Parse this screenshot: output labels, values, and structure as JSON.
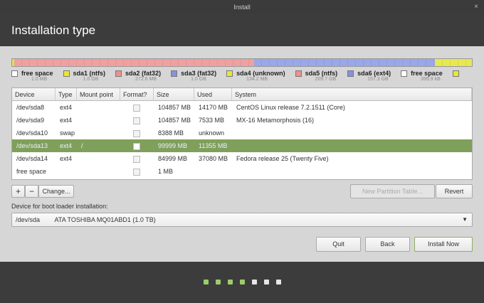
{
  "window": {
    "title": "Install",
    "close_icon": "×"
  },
  "header": {
    "title": "Installation type"
  },
  "partition_bar": [
    {
      "color": "#e0e050",
      "share": 0.4
    },
    {
      "color": "#f0a0a0",
      "share": 52.3
    },
    {
      "color": "#9aa8e8",
      "share": 39.2
    },
    {
      "color": "#e8e850",
      "share": 8.1
    }
  ],
  "legend": [
    {
      "name": "free space",
      "size": "1.0 MB",
      "color": "#ffffff"
    },
    {
      "name": "sda1 (ntfs)",
      "size": "1.0 GB",
      "color": "#e8e830"
    },
    {
      "name": "sda2 (fat32)",
      "size": "272.6 MB",
      "color": "#f09090"
    },
    {
      "name": "sda3 (fat32)",
      "size": "1.0 GB",
      "color": "#8890e0"
    },
    {
      "name": "sda4 (unknown)",
      "size": "134.2 MB",
      "color": "#e8e830"
    },
    {
      "name": "sda5 (ntfs)",
      "size": "209.7 GB",
      "color": "#f09090"
    },
    {
      "name": "sda6 (ext4)",
      "size": "157.3 GB",
      "color": "#8890e0"
    },
    {
      "name": "free space",
      "size": "399.9 kB",
      "color": "#ffffff"
    },
    {
      "name": "",
      "size": "",
      "color": "#e8e830"
    }
  ],
  "table": {
    "headers": [
      "Device",
      "Type",
      "Mount point",
      "Format?",
      "Size",
      "Used",
      "System"
    ],
    "rows": [
      {
        "device": "/dev/sda8",
        "type": "ext4",
        "mount": "",
        "format": false,
        "size": "104857 MB",
        "used": "14170 MB",
        "system": "CentOS Linux release 7.2.1511 (Core)"
      },
      {
        "device": "/dev/sda9",
        "type": "ext4",
        "mount": "",
        "format": false,
        "size": "104857 MB",
        "used": "7533 MB",
        "system": "MX-16 Metamorphosis (16)"
      },
      {
        "device": "/dev/sda10",
        "type": "swap",
        "mount": "",
        "format": false,
        "size": "8388 MB",
        "used": "unknown",
        "system": ""
      },
      {
        "device": "/dev/sda13",
        "type": "ext4",
        "mount": "/",
        "format": true,
        "size": "99999 MB",
        "used": "11355 MB",
        "system": "",
        "selected": true
      },
      {
        "device": "/dev/sda14",
        "type": "ext4",
        "mount": "",
        "format": false,
        "size": "84999 MB",
        "used": "37080 MB",
        "system": "Fedora release 25 (Twenty Five)"
      },
      {
        "device": "free space",
        "type": "",
        "mount": "",
        "format": false,
        "size": "1 MB",
        "used": "",
        "system": ""
      }
    ]
  },
  "buttons": {
    "add": "+",
    "remove": "−",
    "change": "Change...",
    "new_table": "New Partition Table...",
    "revert": "Revert",
    "quit": "Quit",
    "back": "Back",
    "install": "Install Now"
  },
  "bootloader": {
    "label": "Device for boot loader installation:",
    "device": "/dev/sda",
    "description": "ATA TOSHIBA MQ01ABD1 (1.0 TB)"
  },
  "progress": {
    "completed_steps": 4,
    "total_steps": 7,
    "done_color": "#9ccc6c",
    "todo_color": "#e6e6e6"
  }
}
